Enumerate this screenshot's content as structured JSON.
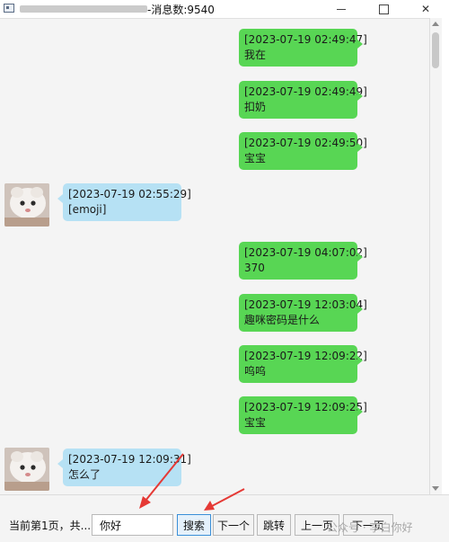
{
  "window": {
    "title_suffix": "-消息数:9540",
    "controls": [
      "minimize",
      "maximize",
      "close"
    ]
  },
  "messages": [
    {
      "side": "right",
      "timestamp": "[2023-07-19 02:49:47]",
      "text": "我在"
    },
    {
      "side": "right",
      "timestamp": "[2023-07-19 02:49:49]",
      "text": "扣奶"
    },
    {
      "side": "right",
      "timestamp": "[2023-07-19 02:49:50]",
      "text": "宝宝"
    },
    {
      "side": "left",
      "timestamp": "[2023-07-19 02:55:29]",
      "text": "[emoji]"
    },
    {
      "side": "right",
      "timestamp": "[2023-07-19 04:07:02]",
      "text": "370"
    },
    {
      "side": "right",
      "timestamp": "[2023-07-19 12:03:04]",
      "text": "趣咪密码是什么"
    },
    {
      "side": "right",
      "timestamp": "[2023-07-19 12:09:22]",
      "text": "呜呜"
    },
    {
      "side": "right",
      "timestamp": "[2023-07-19 12:09:25]",
      "text": "宝宝"
    },
    {
      "side": "left",
      "timestamp": "[2023-07-19 12:09:31]",
      "text": "怎么了"
    }
  ],
  "bottom": {
    "page_info": "当前第1页，共...",
    "search_value": "你好",
    "search_label": "搜索",
    "next_label": "下一个",
    "jump_label": "跳转",
    "prev_page_label": "上一页",
    "next_page_label": "下一页",
    "watermark": "公众号 · 李白你好"
  },
  "colors": {
    "sent_bubble": "#58d654",
    "received_bubble": "#b6e1f4",
    "annotation_arrow": "#e53935"
  }
}
